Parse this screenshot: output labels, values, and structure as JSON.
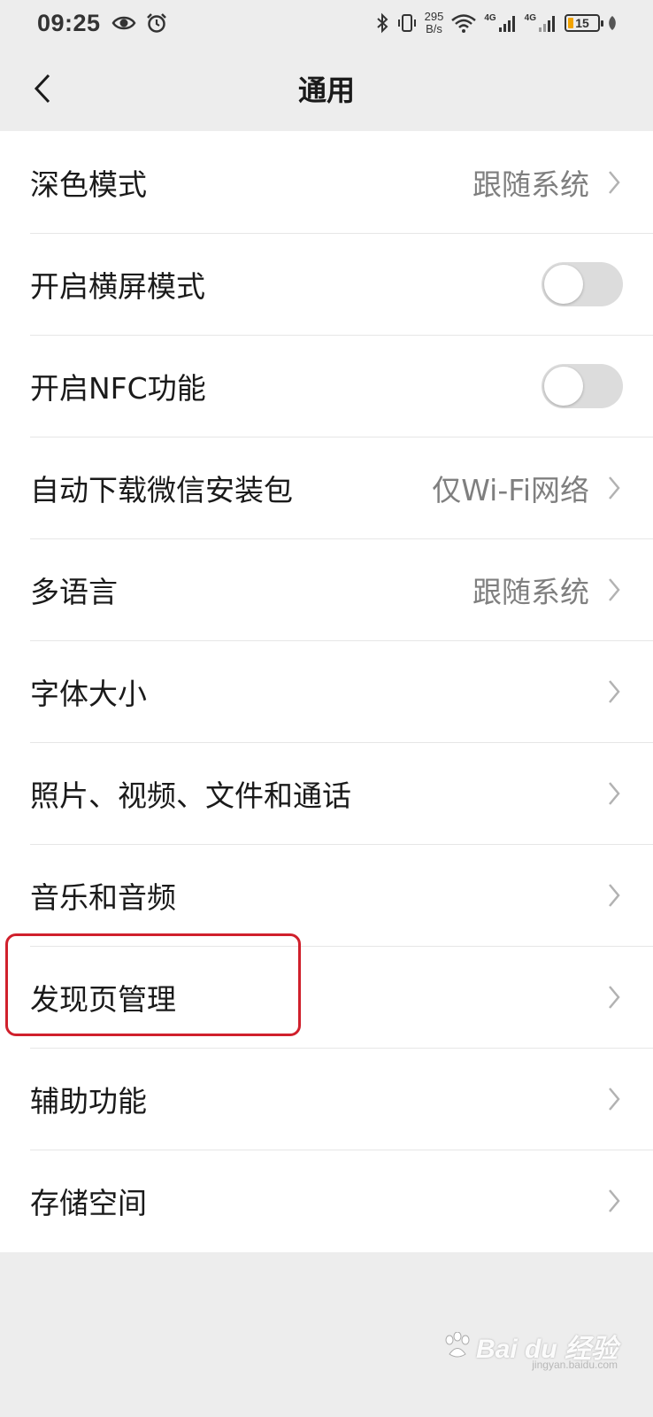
{
  "status_bar": {
    "time": "09:25",
    "net_speed_value": "295",
    "net_speed_unit": "B/s",
    "network_1": "4G",
    "network_2": "4G",
    "battery": "15",
    "battery_fill_color": "#f2a300"
  },
  "nav": {
    "title": "通用"
  },
  "settings": [
    {
      "label": "深色模式",
      "value": "跟随系统"
    },
    {
      "label": "开启横屏模式",
      "toggle": "off"
    },
    {
      "label": "开启NFC功能",
      "toggle": "off"
    },
    {
      "label": "自动下载微信安装包",
      "value": "仅Wi-Fi网络"
    },
    {
      "label": "多语言",
      "value": "跟随系统"
    },
    {
      "label": "字体大小"
    },
    {
      "label": "照片、视频、文件和通话"
    },
    {
      "label": "音乐和音频"
    },
    {
      "label": "发现页管理",
      "highlighted": true
    },
    {
      "label": "辅助功能"
    },
    {
      "label": "存储空间"
    }
  ],
  "watermark": {
    "main": "Bai du 经验",
    "sub": "jingyan.baidu.com"
  },
  "colors": {
    "background": "#ededed",
    "highlight": "#d0202c",
    "value_text": "#7f7f7f"
  }
}
